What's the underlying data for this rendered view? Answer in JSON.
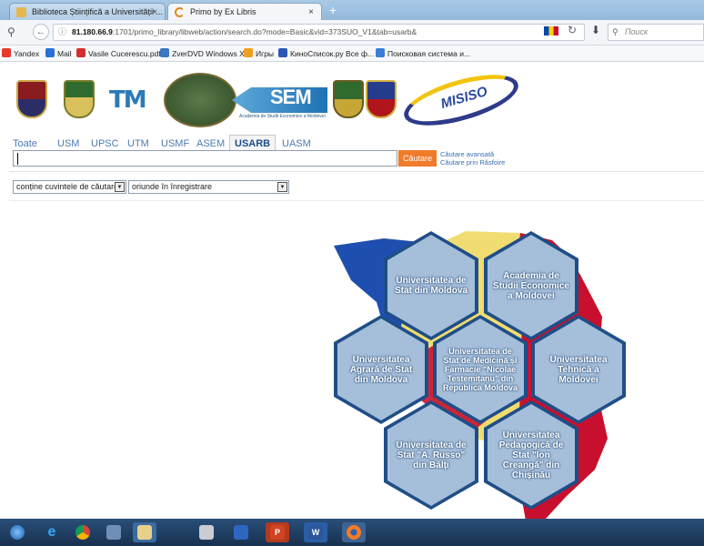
{
  "browser": {
    "tabs": [
      {
        "title": "Biblioteca Științifică a Universității ...",
        "close": "×"
      },
      {
        "title": "Primo by Ex Libris",
        "close": "×"
      }
    ],
    "new_tab": "+",
    "url_host": "81.180.66.9",
    "url_rest": ":1701/primo_library/libweb/action/search.do?mode=Basic&vid=373SUO_V1&tab=usarb&",
    "search_placeholder": "Поиск",
    "bookmarks": [
      {
        "label": "Yandex",
        "color": "#e8382b"
      },
      {
        "label": "Mail",
        "color": "#2a6fd6"
      },
      {
        "label": "Vasile Cucerescu.pdf",
        "color": "#d32f2f"
      },
      {
        "label": "ZverDVD Windows XP",
        "color": "#3a78c3"
      },
      {
        "label": "Игры",
        "color": "#f0a020"
      },
      {
        "label": "КиноСписок.ру Все ф...",
        "color": "#2c57b5"
      },
      {
        "label": "Поисковая система и...",
        "color": "#3b7dd8"
      }
    ]
  },
  "logos": {
    "utm": "TM",
    "asem_word": "SEM",
    "asem_sub": "Academia de Studii Economice a Moldovei",
    "misiso": "MISISO"
  },
  "uni_tabs": [
    "Toate",
    "USM",
    "UPSC",
    "UTM",
    "USMF",
    "ASEM",
    "USARB",
    "UASM"
  ],
  "search": {
    "button": "Căutare",
    "advanced": "Căutare avansată",
    "browse": "Căutare prin Răsfoire"
  },
  "filters": {
    "match": "conține cuvintele de căutare",
    "scope": "oriunde în înregistrare"
  },
  "universities": [
    "Universitatea de Stat din Moldova",
    "Academia de Studii Economice a Moldovei",
    "Universitatea Agrară de Stat din Moldova",
    "Universitatea de Stat de Medicină și Farmacie \"Nicolae Testemițanu\" din Republica Moldova",
    "Universitatea Tehnică a Moldovei",
    "Universitatea de Stat \"A. Russo\" din Bălți",
    "Universitatea Pedagogică de Stat \"Ion Creangă\" din Chișinău"
  ],
  "taskbar": {
    "items": [
      "start",
      "ie",
      "chrome",
      "explorer",
      "files",
      "marc",
      "word-blue",
      "powerpoint",
      "word",
      "firefox"
    ],
    "ppt_letter": "P",
    "word_letter": "W"
  }
}
